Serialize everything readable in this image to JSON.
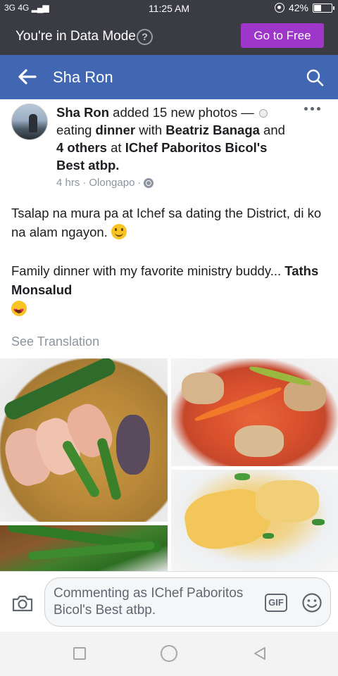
{
  "status_bar": {
    "signal_text": "3G 4G",
    "time": "11:25 AM",
    "battery_percent": "42%",
    "battery_level": 0.42,
    "icons": [
      "signal-icon",
      "hotspot-icon",
      "battery-icon"
    ]
  },
  "data_mode": {
    "label": "You're in Data Mode",
    "help_icon": "question-circle-icon",
    "help_glyph": "?",
    "go_free_label": "Go to Free"
  },
  "header": {
    "back_icon": "back-arrow-icon",
    "title": "Sha Ron",
    "search_icon": "search-icon",
    "background_color": "#4267b2"
  },
  "post": {
    "author": "Sha Ron",
    "action": " added 15 new photos — ",
    "activity": "eating ",
    "activity_bold": "dinner",
    "with_text": " with ",
    "tagged_person": "Beatriz Banaga",
    "and_text": " and ",
    "others": "4 others",
    "at_text": " at ",
    "place": "IChef Paboritos Bicol's Best atbp.",
    "time_ago": "4 hrs",
    "separator": "·",
    "location": "Olongapo",
    "privacy_icon": "globe-icon",
    "more_icon": "more-options-icon",
    "paragraph1": "Tsalap na mura pa at Ichef sa dating the District, di ko na alam ngayon. ",
    "paragraph2": "Family dinner with my favorite ministry buddy... ",
    "mention": "Taths Monsalud",
    "see_translation": "See Translation",
    "photos": [
      "photo-1",
      "photo-2",
      "photo-3",
      "photo-4"
    ]
  },
  "composer": {
    "camera_icon": "camera-icon",
    "placeholder": "Commenting as IChef Paboritos Bicol's Best atbp.",
    "gif_label": "GIF",
    "emoji_icon": "smiley-icon"
  },
  "nav": {
    "recent_icon": "square-icon",
    "home_icon": "circle-icon",
    "back_icon": "triangle-back-icon"
  }
}
